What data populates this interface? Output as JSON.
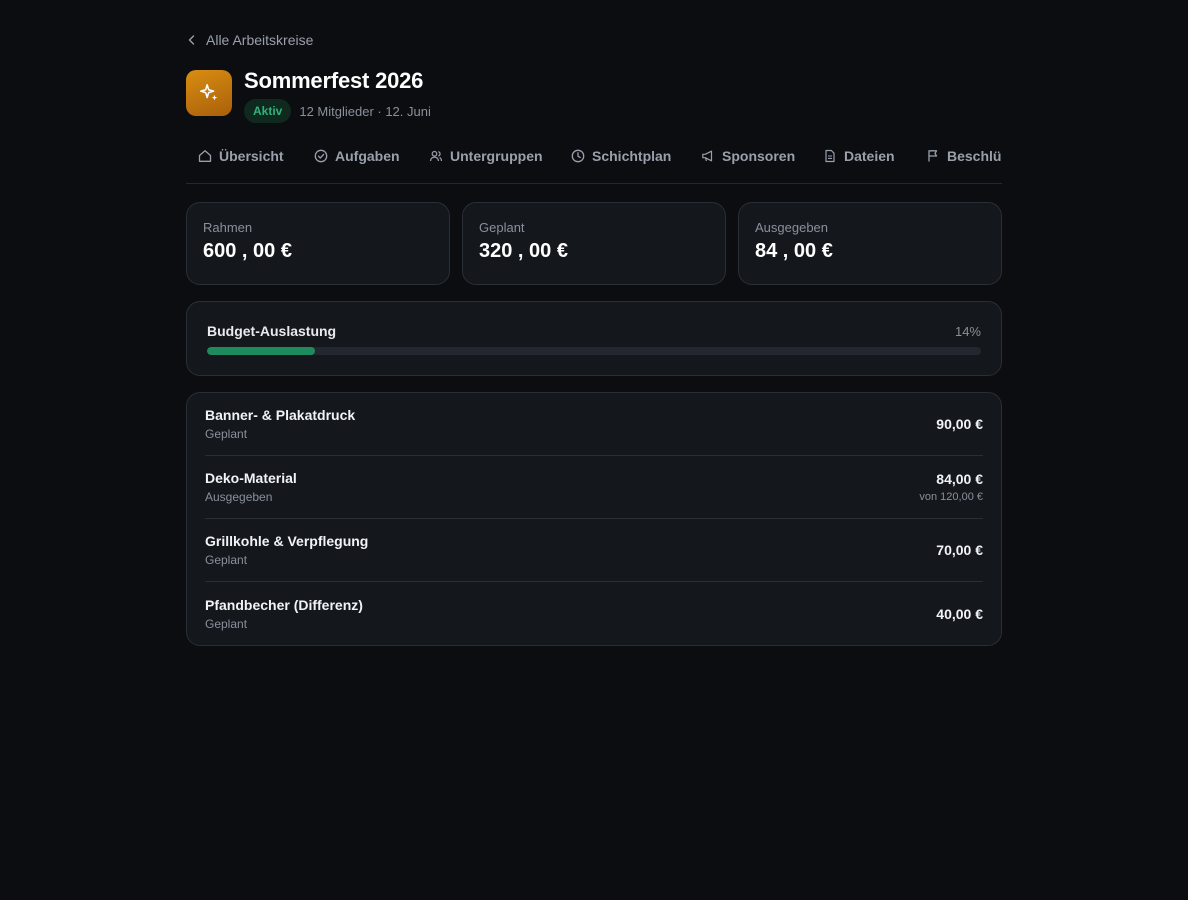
{
  "back_link": "Alle Arbeitskreise",
  "header": {
    "title": "Sommerfest 2026",
    "status": "Aktiv",
    "meta": "12 Mitglieder · 12. Juni"
  },
  "tabs": [
    {
      "label": "Übersicht",
      "icon": "home-icon"
    },
    {
      "label": "Aufgaben",
      "icon": "check-circle-icon"
    },
    {
      "label": "Untergruppen",
      "icon": "users-icon"
    },
    {
      "label": "Schichtplan",
      "icon": "clock-icon"
    },
    {
      "label": "Sponsoren",
      "icon": "megaphone-icon"
    },
    {
      "label": "Dateien",
      "icon": "document-icon"
    },
    {
      "label": "Beschlüsse",
      "icon": "flag-icon"
    }
  ],
  "summary": [
    {
      "label": "Rahmen",
      "value": "600 , 00 €"
    },
    {
      "label": "Geplant",
      "value": "320 , 00 €"
    },
    {
      "label": "Ausgegeben",
      "value": "84 , 00 €"
    }
  ],
  "budget": {
    "label": "Budget-Auslastung",
    "percent_text": "14%",
    "fraction": 0.14,
    "bar_color": "#1f8a5c"
  },
  "items": [
    {
      "name": "Banner- & Plakatdruck",
      "status": "Geplant",
      "amount": "90,00 €",
      "sub": ""
    },
    {
      "name": "Deko-Material",
      "status": "Ausgegeben",
      "amount": "84,00 €",
      "sub": "von 120,00 €"
    },
    {
      "name": "Grillkohle & Verpflegung",
      "status": "Geplant",
      "amount": "70,00 €",
      "sub": ""
    },
    {
      "name": "Pfandbecher (Differenz)",
      "status": "Geplant",
      "amount": "40,00 €",
      "sub": ""
    }
  ],
  "colors": {
    "background": "#0b0d11",
    "card": "#14171c",
    "accent_green": "#2fb27a",
    "app_icon": "#c97a0e"
  }
}
